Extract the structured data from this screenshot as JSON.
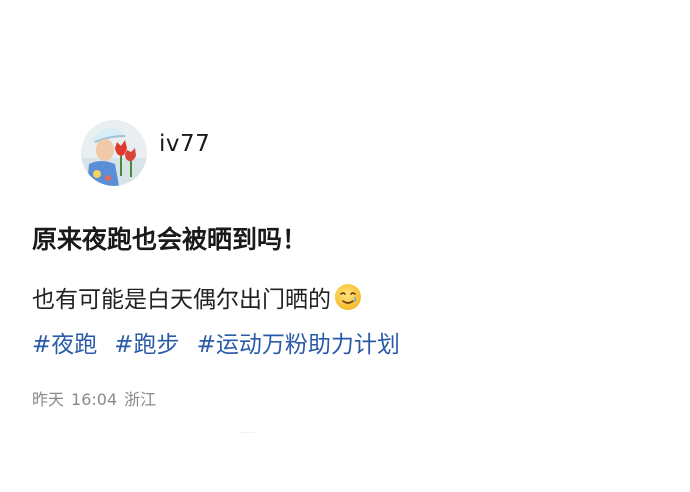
{
  "author": {
    "username": "iv77",
    "avatar_icon": "avatar-photo"
  },
  "post": {
    "title": "原来夜跑也会被晒到吗！",
    "body": "也有可能是白天偶尔出门晒的",
    "emoji_icon": "smiling-face-with-tear-icon",
    "tags": [
      "#夜跑",
      "#跑步",
      "#运动万粉助力计划"
    ]
  },
  "meta": {
    "date": "昨天",
    "time": "16:04",
    "location": "浙江"
  },
  "colors": {
    "tag": "#2a5aa8",
    "meta": "#8a8a8a",
    "text": "#1a1a1a"
  }
}
